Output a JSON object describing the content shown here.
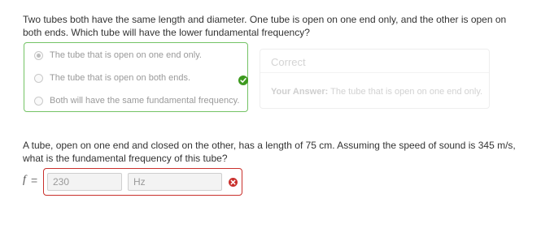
{
  "question1": {
    "text": "Two tubes both have the same length and diameter. One tube is open on one end only, and the other is open on both ends. Which tube will have the lower fundamental frequency?",
    "choices": [
      {
        "label": "The tube that is open on one end only.",
        "selected": true
      },
      {
        "label": "The tube that is open on both ends.",
        "selected": false
      },
      {
        "label": "Both will have the same fundamental frequency.",
        "selected": false
      }
    ],
    "status_icon": "check-icon",
    "feedback": {
      "title": "Correct",
      "answer_label": "Your Answer:",
      "answer_value": "The tube that is open on one end only."
    }
  },
  "question2": {
    "text": "A tube, open on one end and closed on the other, has a length of 75 cm. Assuming the speed of sound is 345 m/s, what is the fundamental frequency of this tube?",
    "variable": "f",
    "equals": "=",
    "value": "230",
    "unit": "Hz",
    "status_icon": "x-icon"
  },
  "colors": {
    "correct": "#3d9a1e",
    "correct_border": "#74c365",
    "incorrect": "#c9302c"
  }
}
